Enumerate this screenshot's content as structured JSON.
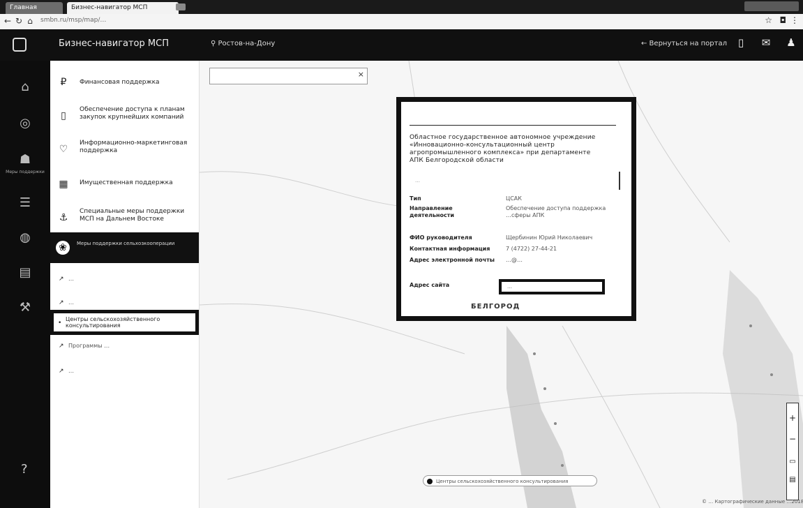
{
  "browser": {
    "tabs": [
      {
        "label": "Главная"
      },
      {
        "label": "Бизнес-навигатор МСП"
      }
    ],
    "new_tab_icon": "plus",
    "url": "smbn.ru/msp/map/…"
  },
  "header": {
    "title": "Бизнес-навигатор МСП",
    "city": "Ростов-на-Дону",
    "back_link": "← Вернуться на портал",
    "icons": [
      "tablet-icon",
      "chat-icon",
      "bell-icon"
    ]
  },
  "rail": {
    "items": [
      {
        "label": ""
      },
      {
        "label": ""
      },
      {
        "label": ""
      },
      {
        "label": "Меры поддержки"
      },
      {
        "label": ""
      },
      {
        "label": ""
      },
      {
        "label": ""
      },
      {
        "label": ""
      }
    ],
    "help": "?"
  },
  "sidebar": {
    "items": [
      {
        "label": "Финансовая поддержка"
      },
      {
        "label": "Обеспечение доступа к планам закупок крупнейших компаний"
      },
      {
        "label": "Информационно-маркетинговая поддержка"
      },
      {
        "label": "Имущественная поддержка"
      },
      {
        "label": "Специальные меры поддержки МСП на Дальнем Востоке"
      }
    ],
    "active": {
      "label": "Меры поддержки сельхозкооперации"
    },
    "subitems": [
      {
        "label": "…"
      },
      {
        "label": "…"
      },
      {
        "label": "Центры сельскохозяйственного консультирования"
      },
      {
        "label": "Программы …"
      },
      {
        "label": "…"
      }
    ]
  },
  "map": {
    "search_placeholder": "",
    "popup": {
      "org_name": "Областное государственное автономное учреждение «Инновационно-консультационный центр агропромышленного комплекса» при департаменте АПК Белгородской области",
      "address": "…",
      "rows": [
        {
          "key": "Тип",
          "value": "ЦСАК"
        },
        {
          "key": "Направление деятельности",
          "value": "Обеспечение доступа поддержка …сферы АПК"
        },
        {
          "key": "ФИО руководителя",
          "value": "Щербинин Юрий Николаевич"
        },
        {
          "key": "Контактная информация",
          "value": "7 (4722) 27-44-21"
        },
        {
          "key": "Адрес электронной почты",
          "value": "…@…"
        },
        {
          "key": "Адрес сайта",
          "value": "…"
        }
      ],
      "footer": "БЕЛГОРОД"
    },
    "legend": "Центры сельскохозяйственного консультирования",
    "copyright": "© … Картографические данные …2018",
    "zoom": {
      "in": "+",
      "out": "−"
    }
  },
  "colors": {
    "header_bg": "#101010",
    "rail_bg": "#0d0d0d",
    "highlight": "#111111"
  }
}
